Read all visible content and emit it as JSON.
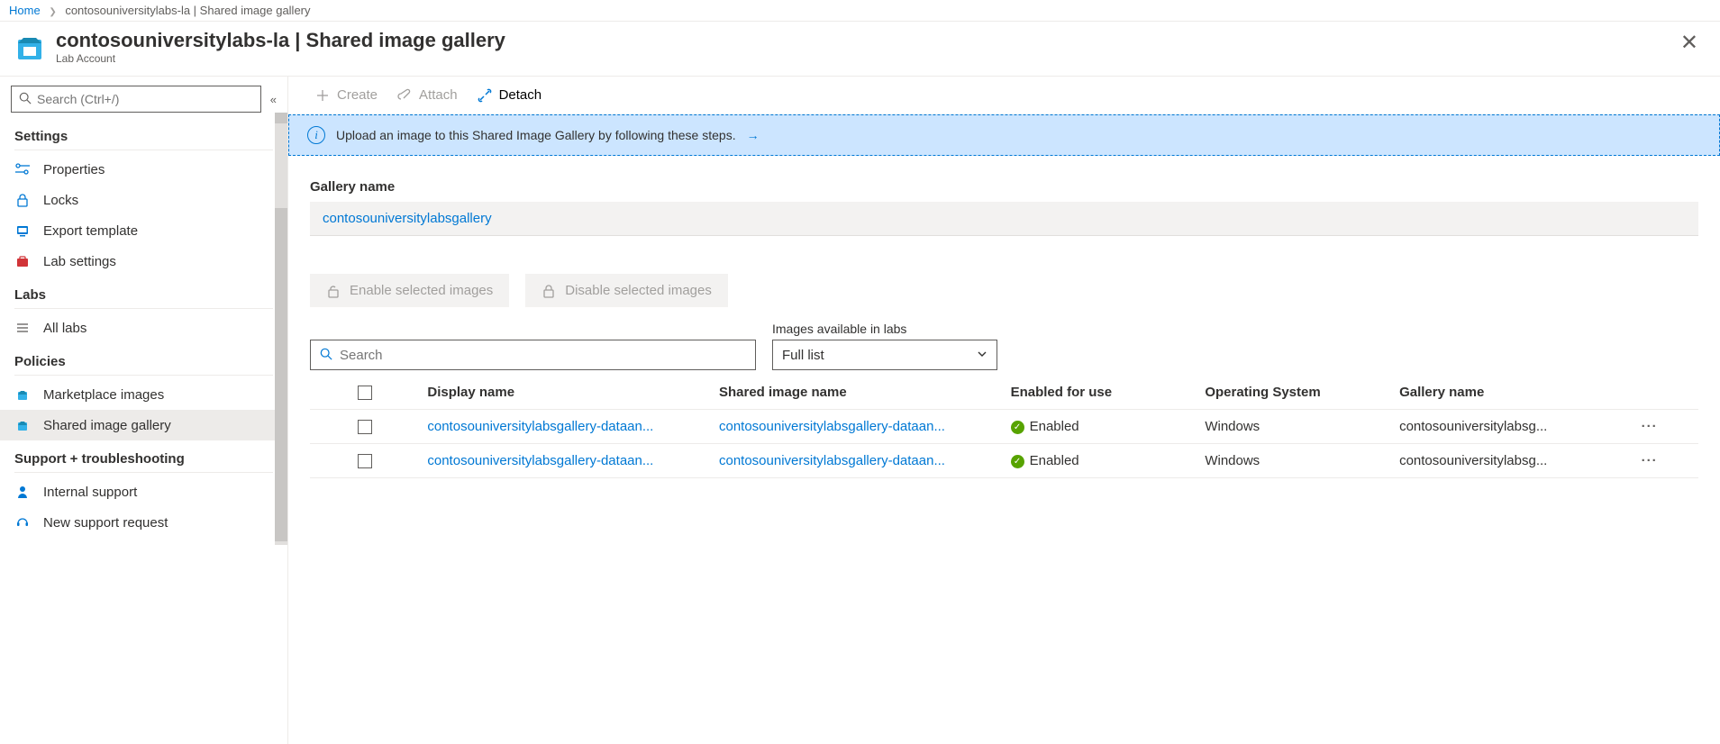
{
  "breadcrumb": {
    "home": "Home",
    "current": "contosouniversitylabs-la | Shared image gallery"
  },
  "header": {
    "title": "contosouniversitylabs-la | Shared image gallery",
    "subtitle": "Lab Account"
  },
  "sidebar": {
    "search_placeholder": "Search (Ctrl+/)",
    "sections": {
      "settings": "Settings",
      "labs": "Labs",
      "policies": "Policies",
      "support": "Support + troubleshooting"
    },
    "items": {
      "properties": "Properties",
      "locks": "Locks",
      "export_template": "Export template",
      "lab_settings": "Lab settings",
      "all_labs": "All labs",
      "marketplace_images": "Marketplace images",
      "shared_image_gallery": "Shared image gallery",
      "internal_support": "Internal support",
      "new_support_request": "New support request"
    }
  },
  "toolbar": {
    "create": "Create",
    "attach": "Attach",
    "detach": "Detach"
  },
  "banner": {
    "text": "Upload an image to this Shared Image Gallery by following these steps."
  },
  "content": {
    "gallery_name_label": "Gallery name",
    "gallery_name_value": "contosouniversitylabsgallery",
    "enable_btn": "Enable selected images",
    "disable_btn": "Disable selected images",
    "search_placeholder": "Search",
    "dropdown_label": "Images available in labs",
    "dropdown_value": "Full list"
  },
  "table": {
    "headers": {
      "display_name": "Display name",
      "shared_image_name": "Shared image name",
      "enabled": "Enabled for use",
      "os": "Operating System",
      "gallery": "Gallery name"
    },
    "rows": [
      {
        "display_name": "contosouniversitylabsgallery-dataan...",
        "shared_image_name": "contosouniversitylabsgallery-dataan...",
        "enabled": "Enabled",
        "os": "Windows",
        "gallery": "contosouniversitylabsg..."
      },
      {
        "display_name": "contosouniversitylabsgallery-dataan...",
        "shared_image_name": "contosouniversitylabsgallery-dataan...",
        "enabled": "Enabled",
        "os": "Windows",
        "gallery": "contosouniversitylabsg..."
      }
    ]
  }
}
